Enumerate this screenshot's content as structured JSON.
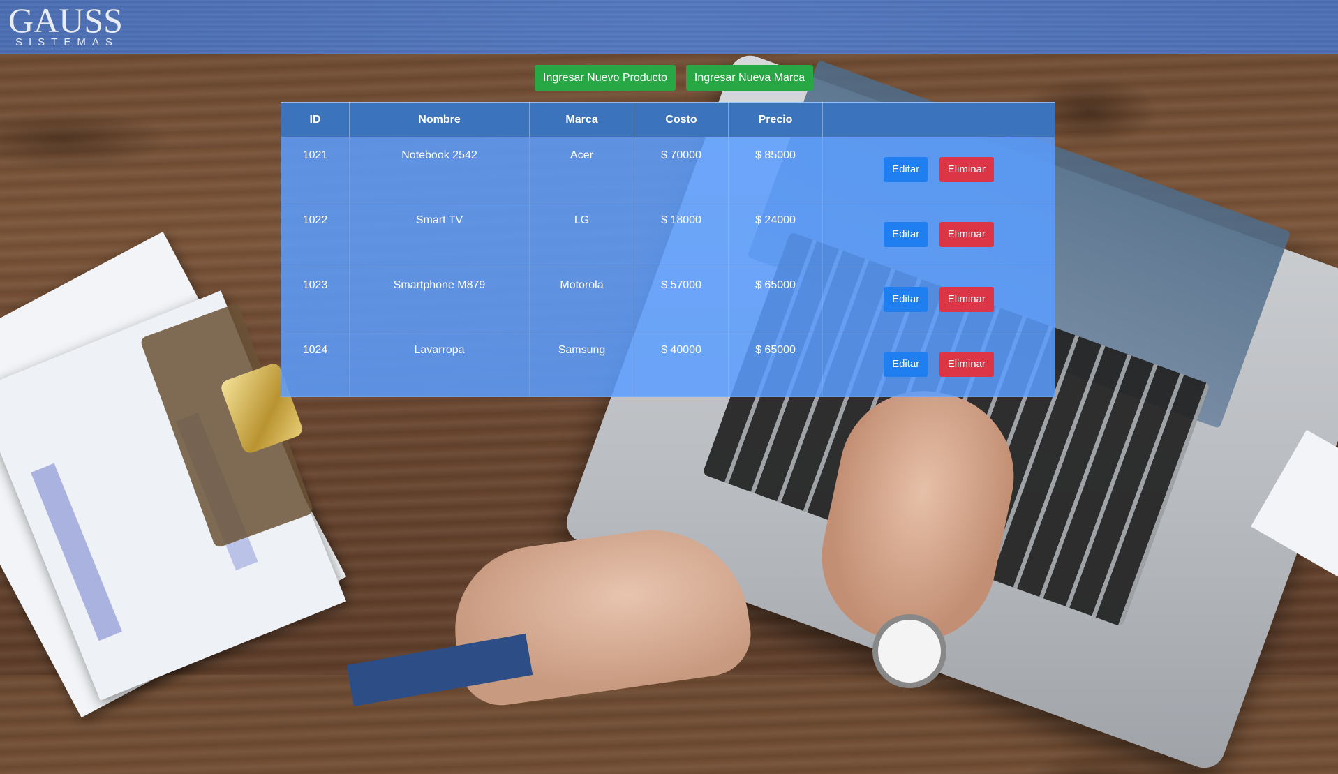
{
  "header": {
    "logo_main": "GAUSS",
    "logo_sub": "SISTEMAS"
  },
  "actions": {
    "new_product": "Ingresar Nuevo Producto",
    "new_brand": "Ingresar Nueva Marca"
  },
  "table": {
    "columns": [
      "ID",
      "Nombre",
      "Marca",
      "Costo",
      "Precio",
      ""
    ],
    "rows": [
      {
        "id": "1021",
        "nombre": "Notebook 2542",
        "marca": "Acer",
        "costo": "$ 70000",
        "precio": "$ 85000"
      },
      {
        "id": "1022",
        "nombre": "Smart TV",
        "marca": "LG",
        "costo": "$ 18000",
        "precio": "$ 24000"
      },
      {
        "id": "1023",
        "nombre": "Smartphone M879",
        "marca": "Motorola",
        "costo": "$ 57000",
        "precio": "$ 65000"
      },
      {
        "id": "1024",
        "nombre": "Lavarropa",
        "marca": "Samsung",
        "costo": "$ 40000",
        "precio": "$ 65000"
      }
    ],
    "edit_label": "Editar",
    "delete_label": "Eliminar"
  },
  "colors": {
    "header_bg": "#4f73ba",
    "table_header_bg": "#3b74bd",
    "table_body_bg": "#5a9eff",
    "green": "#28a745",
    "blue": "#1f7ef0",
    "red": "#dc3545"
  }
}
